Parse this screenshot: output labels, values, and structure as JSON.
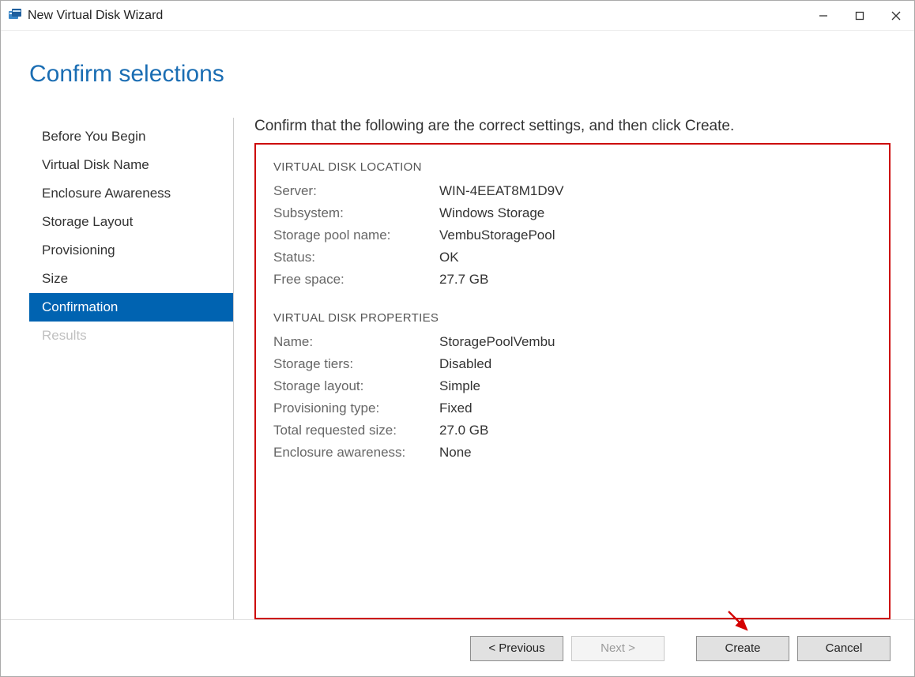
{
  "window": {
    "title": "New Virtual Disk Wizard"
  },
  "page": {
    "title": "Confirm selections",
    "instruction": "Confirm that the following are the correct settings, and then click Create."
  },
  "sidebar": {
    "items": [
      {
        "label": "Before You Begin",
        "state": "normal"
      },
      {
        "label": "Virtual Disk Name",
        "state": "normal"
      },
      {
        "label": "Enclosure Awareness",
        "state": "normal"
      },
      {
        "label": "Storage Layout",
        "state": "normal"
      },
      {
        "label": "Provisioning",
        "state": "normal"
      },
      {
        "label": "Size",
        "state": "normal"
      },
      {
        "label": "Confirmation",
        "state": "selected"
      },
      {
        "label": "Results",
        "state": "disabled"
      }
    ]
  },
  "sections": {
    "location": {
      "header": "VIRTUAL DISK LOCATION",
      "rows": [
        {
          "label": "Server:",
          "value": "WIN-4EEAT8M1D9V"
        },
        {
          "label": "Subsystem:",
          "value": "Windows Storage"
        },
        {
          "label": "Storage pool name:",
          "value": "VembuStoragePool"
        },
        {
          "label": "Status:",
          "value": "OK"
        },
        {
          "label": "Free space:",
          "value": "27.7 GB"
        }
      ]
    },
    "properties": {
      "header": "VIRTUAL DISK PROPERTIES",
      "rows": [
        {
          "label": "Name:",
          "value": "StoragePoolVembu"
        },
        {
          "label": "Storage tiers:",
          "value": "Disabled"
        },
        {
          "label": "Storage layout:",
          "value": "Simple"
        },
        {
          "label": "Provisioning type:",
          "value": "Fixed"
        },
        {
          "label": "Total requested size:",
          "value": "27.0 GB"
        },
        {
          "label": "Enclosure awareness:",
          "value": "None"
        }
      ]
    }
  },
  "footer": {
    "previous": "< Previous",
    "next": "Next >",
    "create": "Create",
    "cancel": "Cancel"
  }
}
